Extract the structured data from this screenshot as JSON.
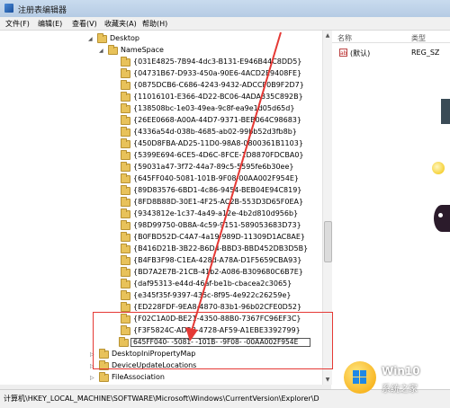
{
  "window": {
    "title": "注册表编辑器"
  },
  "menu": [
    "文件(F)",
    "编辑(E)",
    "查看(V)",
    "收藏夹(A)",
    "帮助(H)"
  ],
  "tree": {
    "desktop": "Desktop",
    "namespace": "NameSpace",
    "keys": [
      "{031E4825-7B94-4dc3-B131-E946B44C8DD5}",
      "{04731B67-D933-450a-90E6-4ACD2E9408FE}",
      "{0875DCB6-C686-4243-9432-ADCCF0B9F2D7}",
      "{11016101-E366-4D22-BC06-4ADA335C892B}",
      "{138508bc-1e03-49ea-9c8f-ea9e1d05d65d}",
      "{26EE0668-A00A-44D7-9371-BEB064C98683}",
      "{4336a54d-038b-4685-ab02-99bb52d3fb8b}",
      "{450D8FBA-AD25-11D0-98A8-0800361B1103}",
      "{5399E694-6CE5-4D6C-8FCE-1D8870FDCBA0}",
      "{59031a47-3f72-44a7-89c5-5595fe6b30ee}",
      "{645FF040-5081-101B-9F08-00AA002F954E}",
      "{89D83576-6BD1-4c86-9454-BEB04E94C819}",
      "{8FD8B88D-30E1-4F25-AC2B-553D3D65F0EA}",
      "{9343812e-1c37-4a49-a12e-4b2d810d956b}",
      "{98D99750-0B8A-4c59-9151-589053683D73}",
      "{B0FBD52D-C4A7-4a19-989D-11309D1AC8AE}",
      "{B416D21B-3B22-B6D4-BBD3-BBD452DB3D5B}",
      "{B4FB3F98-C1EA-428d-A78A-D1F5659CBA93}",
      "{BD7A2E7B-21CB-41b2-A086-B309680C6B7E}",
      "{daf95313-e44d-46af-be1b-cbacea2c3065}",
      "{e345f35f-9397-435c-8f95-4e922c26259e}",
      "{ED228FDF-9EA8-4870-83b1-96b02CFE0D52}",
      "{F02C1A0D-BE21-4350-88B0-7367FC96EF3C}",
      "{F3F5824C-AD58-4728-AF59-A1EBE3392799}"
    ],
    "editing_value": "645FF040- -5081- -101B- -9F08- -00AA002F954E",
    "after": [
      "DesktopIniPropertyMap",
      "DeviceUpdateLocations",
      "FileAssociation"
    ]
  },
  "right_pane": {
    "col_name": "名称",
    "col_type": "类型",
    "default_name": "(默认)",
    "default_type": "REG_SZ",
    "ab_label": "ab"
  },
  "statusbar": "计算机\\HKEY_LOCAL_MACHINE\\SOFTWARE\\Microsoft\\Windows\\CurrentVersion\\Explorer\\D",
  "watermark": {
    "name": "Win10",
    "sub": "系统之家"
  },
  "colors": {
    "highlight": "#e53935",
    "folder": "#e8c25a"
  }
}
